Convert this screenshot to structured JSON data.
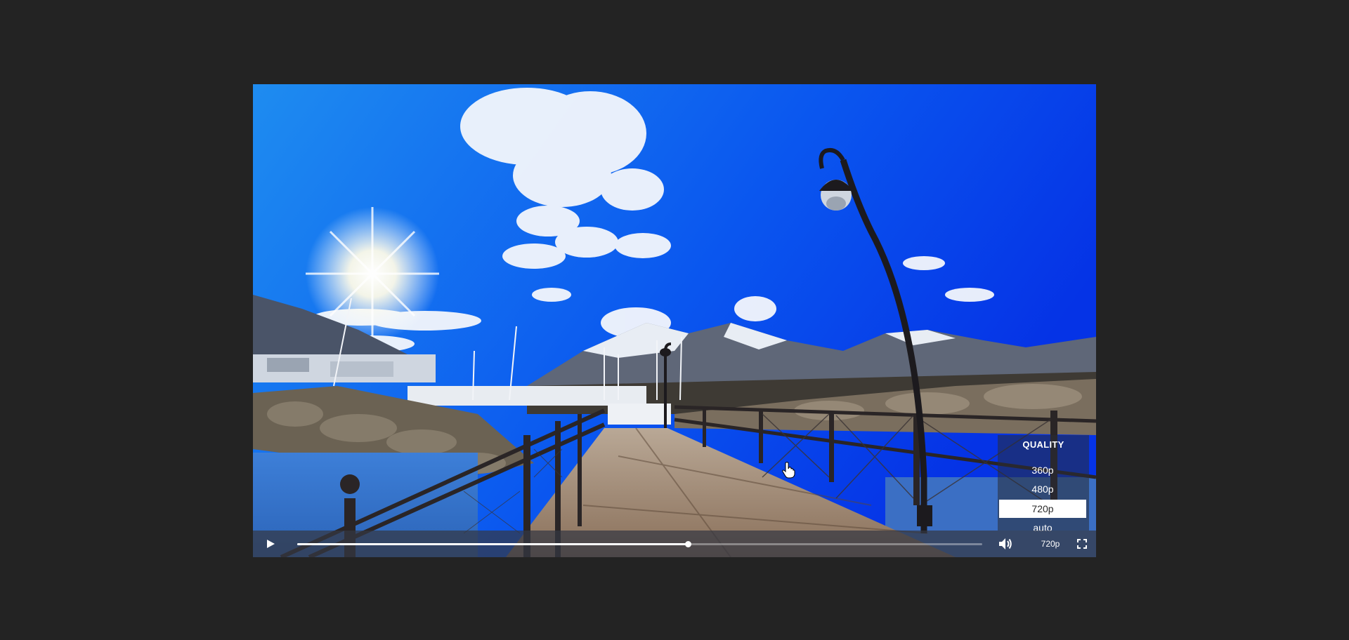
{
  "player": {
    "quality_menu": {
      "title": "QUALITY",
      "options": [
        "360p",
        "480p",
        "720p",
        "auto"
      ],
      "selected": "720p"
    },
    "controls": {
      "play_icon": "play-icon",
      "volume_icon": "volume-icon",
      "quality_label": "720p",
      "fullscreen_icon": "fullscreen-icon",
      "progress_fraction": 0.57
    },
    "colors": {
      "page_background": "#232323",
      "control_bar": "#343842",
      "selected_option_bg": "#ffffff"
    }
  }
}
